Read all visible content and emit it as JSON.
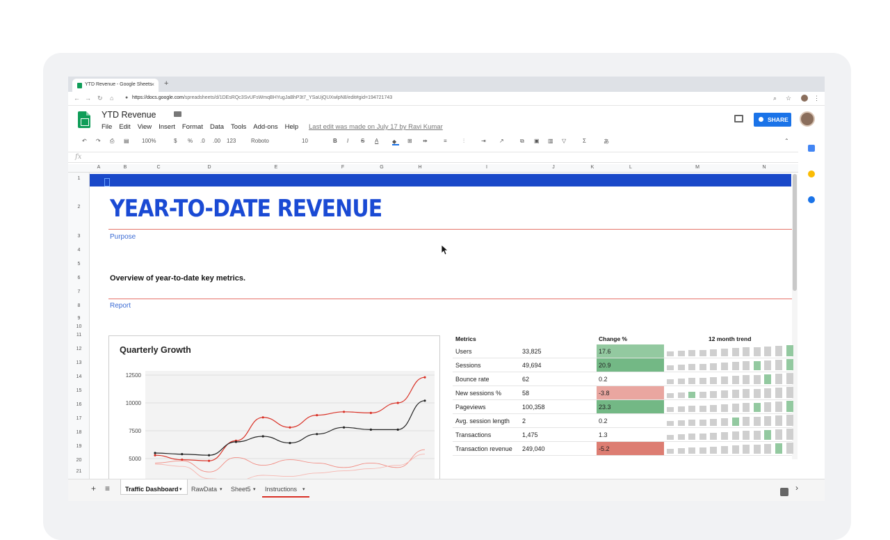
{
  "browser": {
    "tab_title": "YTD Revenue - Google Sheets",
    "tab_close": "×",
    "new_tab": "+",
    "url_host": "https://docs.google.com",
    "url_path": "/spreadsheets/d/1DEsRQc3SvUFsWmqBHYugJaBhP3t7_YSaUjQUXwlpN8/edit#gid=194721743",
    "back": "←",
    "forward": "→",
    "reload": "↻",
    "home": "⌂",
    "lock": "🔒",
    "zoom": "🔍",
    "star": "☆",
    "menu": "⋮"
  },
  "header": {
    "doc_title": "YTD Revenue",
    "menu": [
      "File",
      "Edit",
      "View",
      "Insert",
      "Format",
      "Data",
      "Tools",
      "Add-ons",
      "Help"
    ],
    "last_edit": "Last edit was made on July 17 by Ravi Kumar",
    "share_label": "SHARE"
  },
  "toolbar": {
    "undo": "↶",
    "redo": "↷",
    "print": "⎙",
    "paint": "🖌",
    "zoom": "100%",
    "currency": "$",
    "percent": "%",
    "dec_less": ".0",
    "dec_more": ".00",
    "more_formats": "123",
    "font": "Roboto",
    "font_size": "10",
    "bold": "B",
    "italic": "I",
    "strike": "S",
    "text_color": "A",
    "collapse": "⌃"
  },
  "formula_bar": {
    "fx": "fx"
  },
  "columns": [
    "A",
    "B",
    "C",
    "D",
    "E",
    "F",
    "G",
    "H",
    "I",
    "J",
    "K",
    "L",
    "M",
    "N"
  ],
  "rows": [
    "1",
    "2",
    "3",
    "4",
    "5",
    "6",
    "7",
    "8",
    "9",
    "10",
    "11",
    "12",
    "13",
    "14",
    "15",
    "16",
    "17",
    "18",
    "19",
    "20",
    "21"
  ],
  "sheet": {
    "title": "YEAR-TO-DATE REVENUE",
    "purpose_label": "Purpose",
    "overview": "Overview of year-to-date key metrics.",
    "report_label": "Report",
    "accent": "#1a49c9",
    "rule_color": "#e57369"
  },
  "chart_data": {
    "type": "line",
    "title": "Quarterly Growth",
    "y_ticks": [
      "12500",
      "10000",
      "7500",
      "5000"
    ],
    "ylim": [
      3000,
      13000
    ],
    "grid": true,
    "series": [
      {
        "color": "#d93025",
        "values": [
          5300,
          4900,
          4800,
          6600,
          8700,
          7800,
          8900,
          9200,
          9100,
          10000,
          12300
        ]
      },
      {
        "color": "#222222",
        "values": [
          5500,
          5400,
          5300,
          6500,
          7000,
          6400,
          7200,
          7800,
          7600,
          7600,
          10200
        ]
      },
      {
        "color": "#f28b82",
        "values": [
          4600,
          4800,
          3800,
          5100,
          4400,
          4900,
          4600,
          4200,
          4600,
          4200,
          5800
        ]
      },
      {
        "color": "#f6b6b0",
        "values": [
          4500,
          4300,
          3200,
          3000,
          3500,
          3400,
          3700,
          3900,
          4100,
          4400,
          5400
        ]
      }
    ]
  },
  "metrics": {
    "headers": {
      "metric": "Metrics",
      "change": "Change %",
      "trend": "12 month trend"
    },
    "rows": [
      {
        "name": "Users",
        "value": "33,825",
        "change": "17.6",
        "tone": "#93c9a0"
      },
      {
        "name": "Sessions",
        "value": "49,694",
        "change": "20.9",
        "tone": "#73b885"
      },
      {
        "name": "Bounce rate",
        "value": "62",
        "change": "0.2",
        "tone": ""
      },
      {
        "name": "New sessions %",
        "value": "58",
        "change": "-3.8",
        "tone": "#e9a6a0"
      },
      {
        "name": "Pageviews",
        "value": "100,358",
        "change": "23.3",
        "tone": "#73b885"
      },
      {
        "name": "Avg. session length",
        "value": "2",
        "change": "0.2",
        "tone": ""
      },
      {
        "name": "Transactions",
        "value": "1,475",
        "change": "1.3",
        "tone": ""
      },
      {
        "name": "Transaction revenue",
        "value": "249,040",
        "change": "-5.2",
        "tone": "#dd7d72"
      }
    ],
    "trend_highlights": [
      [
        11
      ],
      [
        8,
        11
      ],
      [
        9
      ],
      [
        2
      ],
      [
        8,
        11
      ],
      [
        6
      ],
      [
        9
      ],
      [
        10
      ]
    ]
  },
  "sheet_tabs": {
    "add": "+",
    "list": "≡",
    "tabs": [
      "Traffic Dashboard",
      "RawData",
      "Sheet5",
      "Instructions"
    ],
    "dropdown": "▾",
    "nav": "›"
  }
}
